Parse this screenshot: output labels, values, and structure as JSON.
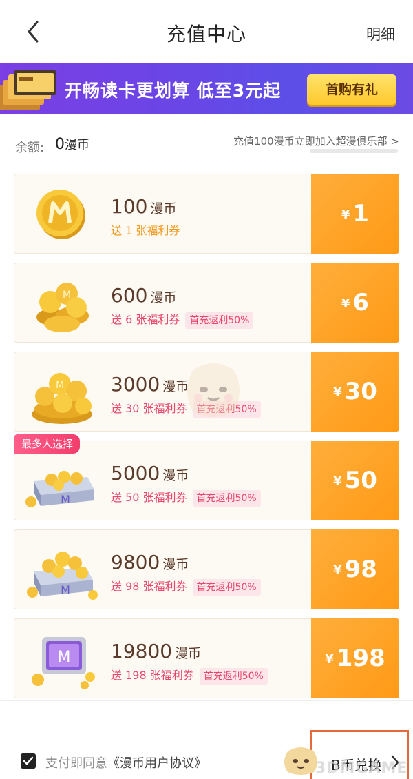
{
  "header": {
    "title": "充值中心",
    "detail_label": "明细"
  },
  "banner": {
    "text": "开畅读卡更划算 低至3元起",
    "button_label": "首购有礼"
  },
  "balance": {
    "label": "余额:",
    "value": "0",
    "unit": "漫币",
    "club_link": "充值100漫币立即加入超漫俱乐部 >"
  },
  "packages": [
    {
      "amount": "100",
      "unit": "漫币",
      "gift": "送 1 张福利券",
      "promo": "",
      "price": "1",
      "currency": "¥",
      "tag": ""
    },
    {
      "amount": "600",
      "unit": "漫币",
      "gift": "送 6 张福利券",
      "promo": "首充返利50%",
      "price": "6",
      "currency": "¥",
      "tag": ""
    },
    {
      "amount": "3000",
      "unit": "漫币",
      "gift": "送 30 张福利券",
      "promo": "首充返利50%",
      "price": "30",
      "currency": "¥",
      "tag": ""
    },
    {
      "amount": "5000",
      "unit": "漫币",
      "gift": "送 50 张福利券",
      "promo": "首充返利50%",
      "price": "50",
      "currency": "¥",
      "tag": "最多人选择"
    },
    {
      "amount": "9800",
      "unit": "漫币",
      "gift": "送 98 张福利券",
      "promo": "首充返利50%",
      "price": "98",
      "currency": "¥",
      "tag": ""
    },
    {
      "amount": "19800",
      "unit": "漫币",
      "gift": "送 198 张福利券",
      "promo": "首充返利50%",
      "price": "198",
      "currency": "¥",
      "tag": ""
    }
  ],
  "footer": {
    "agree_prefix": "支付即同意",
    "agree_link": "《漫币用户协议》",
    "exchange_label": "B币兑换",
    "checked": true
  },
  "watermark": "3DMGAME",
  "colors": {
    "accent": "#ff9f1f",
    "pink": "#e8466c",
    "banner": "#6b45e6",
    "gift_btn": "#ffd23f"
  }
}
